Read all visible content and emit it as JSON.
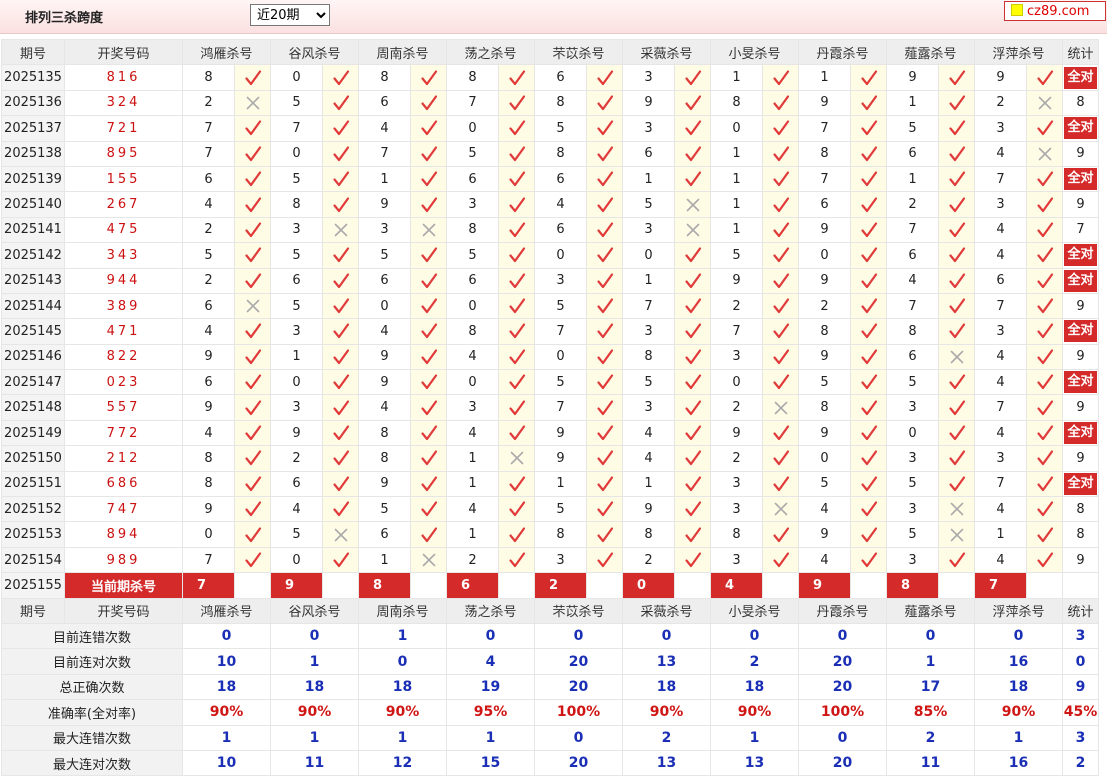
{
  "page": {
    "title": "排列三杀跨度",
    "period_select": "近20期",
    "logo": "cz89.com"
  },
  "columns": {
    "period": "期号",
    "draw": "开奖号码",
    "experts": [
      "鸿雁杀号",
      "谷风杀号",
      "周南杀号",
      "荡之杀号",
      "芣苡杀号",
      "采薇杀号",
      "小旻杀号",
      "丹霞杀号",
      "薤露杀号",
      "浮萍杀号"
    ],
    "stat": "统计"
  },
  "labels": {
    "all_correct": "全对",
    "current_label": "当前期杀号"
  },
  "icons": {
    "correct": "check-icon",
    "wrong": "cross-icon"
  },
  "colors": {
    "correct": "#e03a3a",
    "wrong": "#aaaaaa",
    "badge": "#d42a2a",
    "draw_number": "#cc1111"
  },
  "rows": [
    {
      "period": "2025135",
      "draw": "816",
      "kills": [
        8,
        0,
        8,
        8,
        6,
        3,
        1,
        1,
        9,
        9
      ],
      "ok": [
        1,
        1,
        1,
        1,
        1,
        1,
        1,
        1,
        1,
        1
      ],
      "stat": "全对"
    },
    {
      "period": "2025136",
      "draw": "324",
      "kills": [
        2,
        5,
        6,
        7,
        8,
        9,
        8,
        9,
        1,
        2
      ],
      "ok": [
        0,
        1,
        1,
        1,
        1,
        1,
        1,
        1,
        1,
        0
      ],
      "stat": "8"
    },
    {
      "period": "2025137",
      "draw": "721",
      "kills": [
        7,
        7,
        4,
        0,
        5,
        3,
        0,
        7,
        5,
        3
      ],
      "ok": [
        1,
        1,
        1,
        1,
        1,
        1,
        1,
        1,
        1,
        1
      ],
      "stat": "全对"
    },
    {
      "period": "2025138",
      "draw": "895",
      "kills": [
        7,
        0,
        7,
        5,
        8,
        6,
        1,
        8,
        6,
        4
      ],
      "ok": [
        1,
        1,
        1,
        1,
        1,
        1,
        1,
        1,
        1,
        0
      ],
      "stat": "9"
    },
    {
      "period": "2025139",
      "draw": "155",
      "kills": [
        6,
        5,
        1,
        6,
        6,
        1,
        1,
        7,
        1,
        7
      ],
      "ok": [
        1,
        1,
        1,
        1,
        1,
        1,
        1,
        1,
        1,
        1
      ],
      "stat": "全对"
    },
    {
      "period": "2025140",
      "draw": "267",
      "kills": [
        4,
        8,
        9,
        3,
        4,
        5,
        1,
        6,
        2,
        3
      ],
      "ok": [
        1,
        1,
        1,
        1,
        1,
        0,
        1,
        1,
        1,
        1
      ],
      "stat": "9"
    },
    {
      "period": "2025141",
      "draw": "475",
      "kills": [
        2,
        3,
        3,
        8,
        6,
        3,
        1,
        9,
        7,
        4
      ],
      "ok": [
        1,
        0,
        0,
        1,
        1,
        0,
        1,
        1,
        1,
        1
      ],
      "stat": "7"
    },
    {
      "period": "2025142",
      "draw": "343",
      "kills": [
        5,
        5,
        5,
        5,
        0,
        0,
        5,
        0,
        6,
        4
      ],
      "ok": [
        1,
        1,
        1,
        1,
        1,
        1,
        1,
        1,
        1,
        1
      ],
      "stat": "全对"
    },
    {
      "period": "2025143",
      "draw": "944",
      "kills": [
        2,
        6,
        6,
        6,
        3,
        1,
        9,
        9,
        4,
        6
      ],
      "ok": [
        1,
        1,
        1,
        1,
        1,
        1,
        1,
        1,
        1,
        1
      ],
      "stat": "全对"
    },
    {
      "period": "2025144",
      "draw": "389",
      "kills": [
        6,
        5,
        0,
        0,
        5,
        7,
        2,
        2,
        7,
        7
      ],
      "ok": [
        0,
        1,
        1,
        1,
        1,
        1,
        1,
        1,
        1,
        1
      ],
      "stat": "9"
    },
    {
      "period": "2025145",
      "draw": "471",
      "kills": [
        4,
        3,
        4,
        8,
        7,
        3,
        7,
        8,
        8,
        3
      ],
      "ok": [
        1,
        1,
        1,
        1,
        1,
        1,
        1,
        1,
        1,
        1
      ],
      "stat": "全对"
    },
    {
      "period": "2025146",
      "draw": "822",
      "kills": [
        9,
        1,
        9,
        4,
        0,
        8,
        3,
        9,
        6,
        4
      ],
      "ok": [
        1,
        1,
        1,
        1,
        1,
        1,
        1,
        1,
        0,
        1
      ],
      "stat": "9"
    },
    {
      "period": "2025147",
      "draw": "023",
      "kills": [
        6,
        0,
        9,
        0,
        5,
        5,
        0,
        5,
        5,
        4
      ],
      "ok": [
        1,
        1,
        1,
        1,
        1,
        1,
        1,
        1,
        1,
        1
      ],
      "stat": "全对"
    },
    {
      "period": "2025148",
      "draw": "557",
      "kills": [
        9,
        3,
        4,
        3,
        7,
        3,
        2,
        8,
        3,
        7
      ],
      "ok": [
        1,
        1,
        1,
        1,
        1,
        1,
        0,
        1,
        1,
        1
      ],
      "stat": "9"
    },
    {
      "period": "2025149",
      "draw": "772",
      "kills": [
        4,
        9,
        8,
        4,
        9,
        4,
        9,
        9,
        0,
        4
      ],
      "ok": [
        1,
        1,
        1,
        1,
        1,
        1,
        1,
        1,
        1,
        1
      ],
      "stat": "全对"
    },
    {
      "period": "2025150",
      "draw": "212",
      "kills": [
        8,
        2,
        8,
        1,
        9,
        4,
        2,
        0,
        3,
        3
      ],
      "ok": [
        1,
        1,
        1,
        0,
        1,
        1,
        1,
        1,
        1,
        1
      ],
      "stat": "9"
    },
    {
      "period": "2025151",
      "draw": "686",
      "kills": [
        8,
        6,
        9,
        1,
        1,
        1,
        3,
        5,
        5,
        7
      ],
      "ok": [
        1,
        1,
        1,
        1,
        1,
        1,
        1,
        1,
        1,
        1
      ],
      "stat": "全对"
    },
    {
      "period": "2025152",
      "draw": "747",
      "kills": [
        9,
        4,
        5,
        4,
        5,
        9,
        3,
        4,
        3,
        4
      ],
      "ok": [
        1,
        1,
        1,
        1,
        1,
        1,
        0,
        1,
        0,
        1
      ],
      "stat": "8"
    },
    {
      "period": "2025153",
      "draw": "894",
      "kills": [
        0,
        5,
        6,
        1,
        8,
        8,
        8,
        9,
        5,
        1
      ],
      "ok": [
        1,
        0,
        1,
        1,
        1,
        1,
        1,
        1,
        0,
        1
      ],
      "stat": "8"
    },
    {
      "period": "2025154",
      "draw": "989",
      "kills": [
        7,
        0,
        1,
        2,
        3,
        2,
        3,
        4,
        3,
        4
      ],
      "ok": [
        1,
        1,
        0,
        1,
        1,
        1,
        1,
        1,
        1,
        1
      ],
      "stat": "9"
    }
  ],
  "current": {
    "period": "2025155",
    "kills": [
      "7",
      "9",
      "8",
      "6",
      "2",
      "0",
      "4",
      "9",
      "8",
      "7"
    ]
  },
  "summary": [
    {
      "label": "目前连错次数",
      "values": [
        "0",
        "0",
        "1",
        "0",
        "0",
        "0",
        "0",
        "0",
        "0",
        "0"
      ],
      "stat": "3",
      "kind": "num"
    },
    {
      "label": "目前连对次数",
      "values": [
        "10",
        "1",
        "0",
        "4",
        "20",
        "13",
        "2",
        "20",
        "1",
        "16"
      ],
      "stat": "0",
      "kind": "num"
    },
    {
      "label": "总正确次数",
      "values": [
        "18",
        "18",
        "18",
        "19",
        "20",
        "18",
        "18",
        "20",
        "17",
        "18"
      ],
      "stat": "9",
      "kind": "num"
    },
    {
      "label": "准确率(全对率)",
      "values": [
        "90%",
        "90%",
        "90%",
        "95%",
        "100%",
        "90%",
        "90%",
        "100%",
        "85%",
        "90%"
      ],
      "stat": "45%",
      "kind": "pct"
    },
    {
      "label": "最大连错次数",
      "values": [
        "1",
        "1",
        "1",
        "1",
        "0",
        "2",
        "1",
        "0",
        "2",
        "1"
      ],
      "stat": "3",
      "kind": "num"
    },
    {
      "label": "最大连对次数",
      "values": [
        "10",
        "11",
        "12",
        "15",
        "20",
        "13",
        "13",
        "20",
        "11",
        "16"
      ],
      "stat": "2",
      "kind": "num"
    }
  ]
}
